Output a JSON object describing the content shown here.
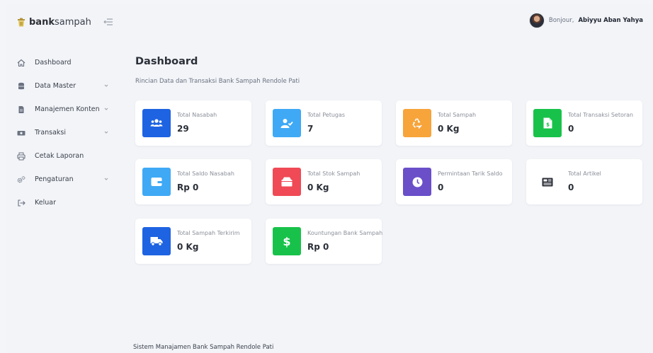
{
  "brand": {
    "bold": "bank",
    "light": "sampah"
  },
  "sidebar": {
    "items": [
      {
        "label": "Dashboard",
        "icon": "home-icon",
        "has_children": false
      },
      {
        "label": "Data Master",
        "icon": "database-icon",
        "has_children": true
      },
      {
        "label": "Manajemen Konten",
        "icon": "file-icon",
        "has_children": true
      },
      {
        "label": "Transaksi",
        "icon": "transaction-icon",
        "has_children": true
      },
      {
        "label": "Cetak Laporan",
        "icon": "printer-icon",
        "has_children": false
      },
      {
        "label": "Pengaturan",
        "icon": "gears-icon",
        "has_children": true
      },
      {
        "label": "Keluar",
        "icon": "logout-icon",
        "has_children": false
      }
    ]
  },
  "topbar": {
    "greeting": "Bonjour,",
    "user_name": "Abiyyu Aban Yahya"
  },
  "main": {
    "title": "Dashboard",
    "subtitle": "Rincian Data dan Transaksi Bank Sampah Rendole Pati"
  },
  "cards": [
    {
      "label": "Total Nasabah",
      "value": "29",
      "icon": "users-icon",
      "color": "#1e63e1"
    },
    {
      "label": "Total Petugas",
      "value": "7",
      "icon": "user-check-icon",
      "color": "#3fa9f5"
    },
    {
      "label": "Total Sampah",
      "value": "0 Kg",
      "icon": "recycle-icon",
      "color": "#f7a43b"
    },
    {
      "label": "Total Transaksi Setoran",
      "value": "0",
      "icon": "file-invoice-icon",
      "color": "#18c24a"
    },
    {
      "label": "Total Saldo Nasabah",
      "value": "Rp 0",
      "icon": "wallet-icon",
      "color": "#3fa9f5"
    },
    {
      "label": "Total Stok Sampah",
      "value": "0 Kg",
      "icon": "box-icon",
      "color": "#ef4a55"
    },
    {
      "label": "Permintaan Tarik Saldo",
      "value": "0",
      "icon": "clock-icon",
      "color": "#6a4fc9"
    },
    {
      "label": "Total Artikel",
      "value": "0",
      "icon": "newspaper-icon",
      "color": ""
    },
    {
      "label": "Total Sampah Terkirim",
      "value": "0 Kg",
      "icon": "truck-icon",
      "color": "#1e63e1"
    },
    {
      "label": "Kountungan Bank Sampah",
      "value": "Rp 0",
      "icon": "dollar-icon",
      "color": "#18c24a"
    }
  ],
  "footer": {
    "text": "Sistem Manajamen Bank Sampah Rendole Pati"
  }
}
